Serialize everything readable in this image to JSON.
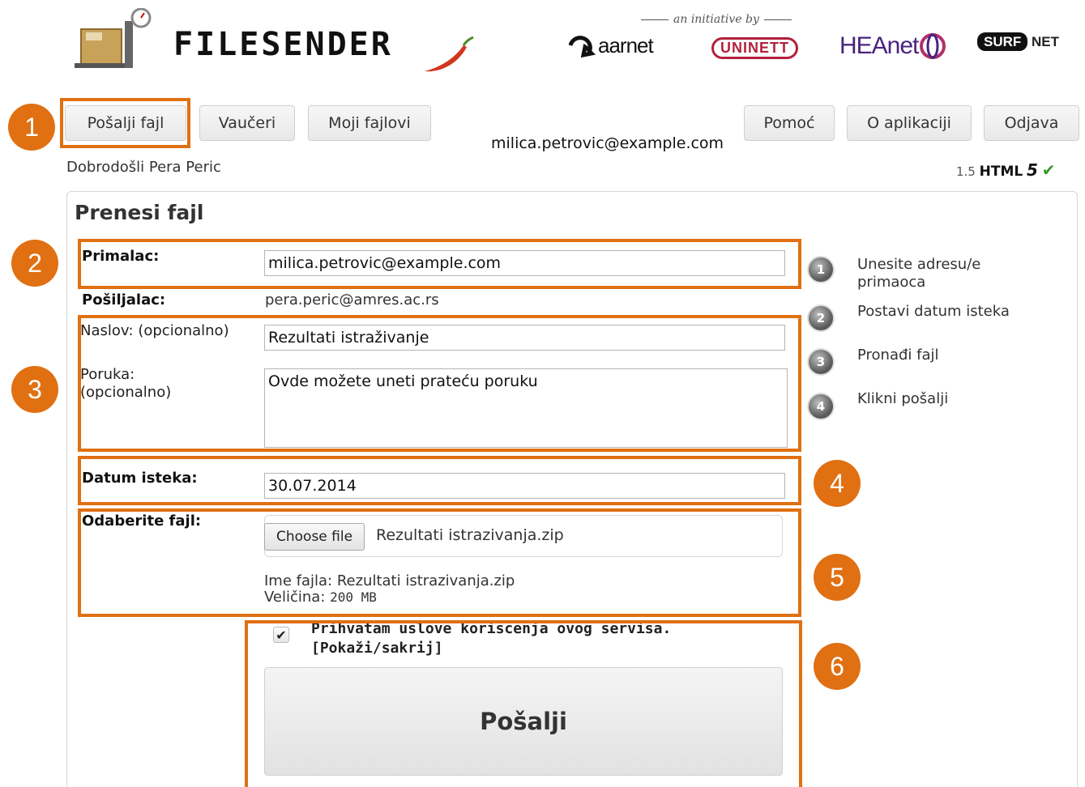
{
  "header": {
    "brand": "FILESENDER",
    "initiative": "an initiative by",
    "partners": [
      "aarnet",
      "UNINETT",
      "HEAnet",
      "SURF",
      "NET"
    ]
  },
  "nav": {
    "send": "Pošalji fajl",
    "vouchers": "Vaučeri",
    "my_files": "Moji fajlovi",
    "help": "Pomoć",
    "about": "O aplikaciji",
    "logout": "Odjava"
  },
  "user": {
    "email": "milica.petrovic@example.com",
    "welcome": "Dobrodošli Pera Peric"
  },
  "version": {
    "number": "1.5",
    "html": "HTML",
    "five": "5"
  },
  "form": {
    "title": "Prenesi fajl",
    "recipient_label": "Primalac:",
    "recipient_value": "milica.petrovic@example.com",
    "sender_label": "Pošiljalac:",
    "sender_value": "pera.peric@amres.ac.rs",
    "subject_label": "Naslov: (opcionalno)",
    "subject_value": "Rezultati istraživanje",
    "message_label_1": "Poruka:",
    "message_label_2": "(opcionalno)",
    "message_value": "Ovde možete uneti prateću poruku",
    "expiry_label": "Datum isteka:",
    "expiry_value": "30.07.2014",
    "file_label": "Odaberite fajl:",
    "choose_file": "Choose file",
    "chosen_file": "Rezultati istrazivanja.zip",
    "file_name_line": "Ime fajla: Rezultati istrazivanja.zip",
    "file_size_label": "Veličina:",
    "file_size_value": "200 MB",
    "terms": "Prihvatam uslove koriscenja ovog servisa.",
    "terms_toggle": "[Pokaži/sakrij]",
    "send_button": "Pošalji"
  },
  "steps": [
    {
      "num": "1",
      "text_1": "Unesite adresu/e",
      "text_2": "primaoca"
    },
    {
      "num": "2",
      "text_1": "Postavi datum isteka"
    },
    {
      "num": "3",
      "text_1": "Pronađi fajl"
    },
    {
      "num": "4",
      "text_1": "Klikni pošalji"
    }
  ],
  "annotations": [
    "1",
    "2",
    "3",
    "4",
    "5",
    "6"
  ],
  "colors": {
    "annotation": "#e07012",
    "heanet": "#4a2480",
    "uninett": "#b3203a"
  }
}
